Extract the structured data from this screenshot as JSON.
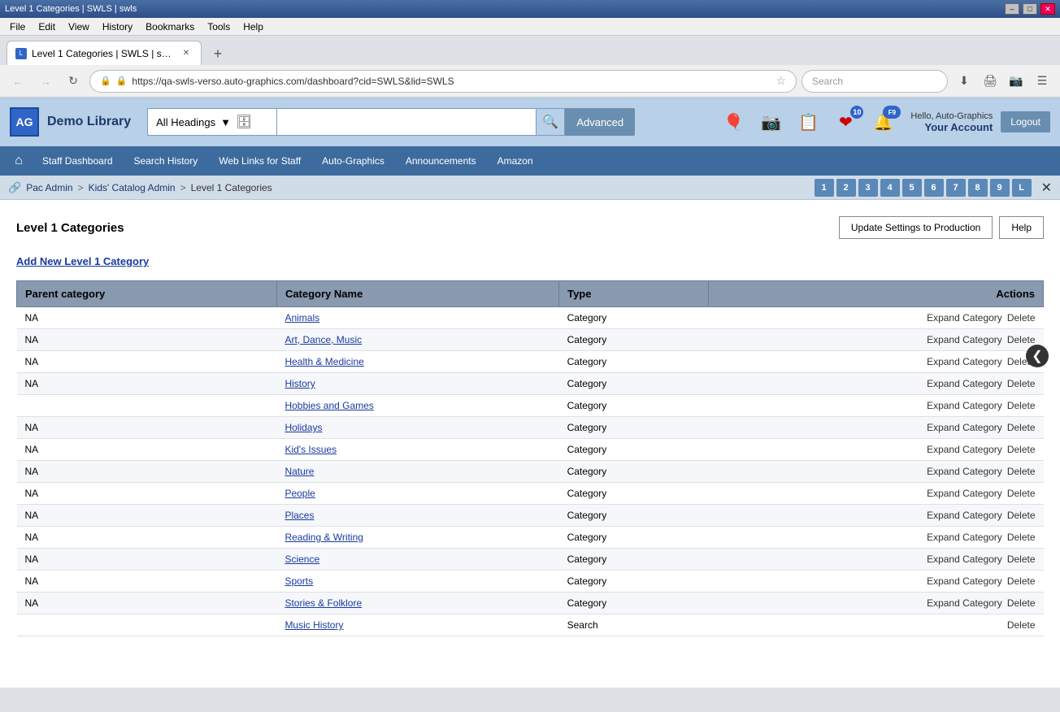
{
  "browser": {
    "titleBar": {
      "title": "Level 1 Categories | SWLS | swls",
      "minimizeLabel": "–",
      "maximizeLabel": "□",
      "closeLabel": "✕"
    },
    "menuItems": [
      "File",
      "Edit",
      "View",
      "History",
      "Bookmarks",
      "Tools",
      "Help"
    ],
    "tab": {
      "favicon": "L",
      "title": "Level 1 Categories | SWLS | swls",
      "closeLabel": "✕"
    },
    "newTabLabel": "+",
    "addressBar": {
      "url": "https://qa-swls-verso.auto-graphics.com/dashboard?cid=SWLS&lid=SWLS",
      "searchPlaceholder": "Search"
    }
  },
  "appHeader": {
    "logoText": "AG",
    "libraryName": "Demo Library",
    "search": {
      "headingOption": "All Headings",
      "placeholder": "",
      "advancedLabel": "Advanced",
      "goIcon": "🔍"
    },
    "icons": {
      "balloon": "🎈",
      "camera": "📷",
      "list": "📋",
      "heart": "❤",
      "bell": "🔔",
      "heartBadge": "10",
      "bellBadge": "F9"
    },
    "userGreeting": "Hello, Auto-Graphics",
    "accountLabel": "Your Account",
    "logoutLabel": "Logout"
  },
  "navBar": {
    "homeIcon": "⌂",
    "items": [
      "Staff Dashboard",
      "Search History",
      "Web Links for Staff",
      "Auto-Graphics",
      "Announcements",
      "Amazon"
    ]
  },
  "breadcrumb": {
    "icon": "🔗",
    "items": [
      "Pac Admin",
      "Kids' Catalog Admin",
      "Level 1 Categories"
    ],
    "letters": [
      "1",
      "2",
      "3",
      "4",
      "5",
      "6",
      "7",
      "8",
      "9",
      "L"
    ],
    "closeLabel": "✕"
  },
  "page": {
    "title": "Level 1 Categories",
    "updateButtonLabel": "Update Settings to Production",
    "helpButtonLabel": "Help",
    "addLinkLabel": "Add New Level 1 Category",
    "tableHeaders": {
      "parentCategory": "Parent category",
      "categoryName": "Category Name",
      "type": "Type",
      "actions": "Actions"
    },
    "rows": [
      {
        "parent": "NA",
        "name": "Animals",
        "type": "Category",
        "expandLabel": "Expand Category",
        "deleteLabel": "Delete"
      },
      {
        "parent": "NA",
        "name": "Art, Dance, Music",
        "type": "Category",
        "expandLabel": "Expand Category",
        "deleteLabel": "Delete"
      },
      {
        "parent": "NA",
        "name": "Health & Medicine",
        "type": "Category",
        "expandLabel": "Expand Category",
        "deleteLabel": "Delete"
      },
      {
        "parent": "NA",
        "name": "History",
        "type": "Category",
        "expandLabel": "Expand Category",
        "deleteLabel": "Delete"
      },
      {
        "parent": "",
        "name": "Hobbies and Games",
        "type": "Category",
        "expandLabel": "Expand Category",
        "deleteLabel": "Delete"
      },
      {
        "parent": "NA",
        "name": "Holidays",
        "type": "Category",
        "expandLabel": "Expand Category",
        "deleteLabel": "Delete"
      },
      {
        "parent": "NA",
        "name": "Kid's Issues",
        "type": "Category",
        "expandLabel": "Expand Category",
        "deleteLabel": "Delete"
      },
      {
        "parent": "NA",
        "name": "Nature",
        "type": "Category",
        "expandLabel": "Expand Category",
        "deleteLabel": "Delete"
      },
      {
        "parent": "NA",
        "name": "People",
        "type": "Category",
        "expandLabel": "Expand Category",
        "deleteLabel": "Delete"
      },
      {
        "parent": "NA",
        "name": "Places",
        "type": "Category",
        "expandLabel": "Expand Category",
        "deleteLabel": "Delete"
      },
      {
        "parent": "NA",
        "name": "Reading & Writing",
        "type": "Category",
        "expandLabel": "Expand Category",
        "deleteLabel": "Delete"
      },
      {
        "parent": "NA",
        "name": "Science",
        "type": "Category",
        "expandLabel": "Expand Category",
        "deleteLabel": "Delete"
      },
      {
        "parent": "NA",
        "name": "Sports",
        "type": "Category",
        "expandLabel": "Expand Category",
        "deleteLabel": "Delete"
      },
      {
        "parent": "NA",
        "name": "Stories & Folklore",
        "type": "Category",
        "expandLabel": "Expand Category",
        "deleteLabel": "Delete"
      },
      {
        "parent": "",
        "name": "Music History",
        "type": "Search",
        "expandLabel": "",
        "deleteLabel": "Delete"
      }
    ]
  },
  "scrollArrow": "❮"
}
